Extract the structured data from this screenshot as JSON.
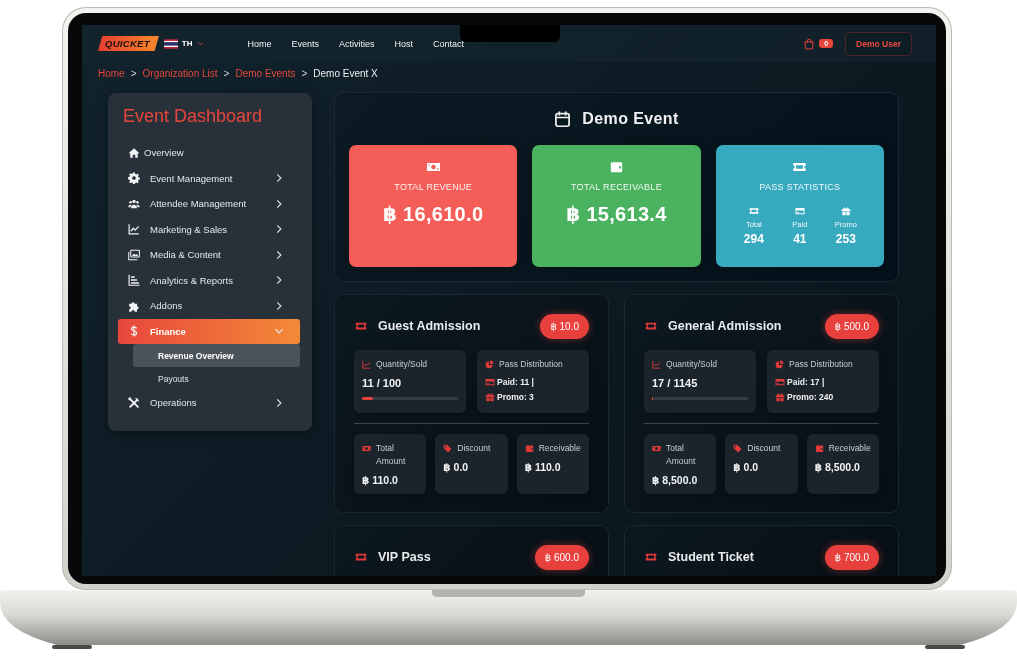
{
  "navbar": {
    "logo": "QUICKET",
    "language": "TH",
    "links": [
      {
        "label": "Home"
      },
      {
        "label": "Events"
      },
      {
        "label": "Activities"
      },
      {
        "label": "Host"
      },
      {
        "label": "Contact"
      }
    ],
    "cart_count": "0",
    "user_button": "Demo User"
  },
  "breadcrumb": [
    {
      "label": "Home",
      "kind": "link"
    },
    {
      "label": "Organization List",
      "kind": "link",
      "separator_before": ">"
    },
    {
      "label": "Demo Events",
      "kind": "link",
      "separator_before": ">"
    },
    {
      "label": "Demo Event X",
      "kind": "current",
      "separator_before": ">"
    }
  ],
  "sidebar": {
    "title": "Event Dashboard",
    "items": [
      {
        "label": "Overview",
        "kind": "link",
        "selected": false
      },
      {
        "label": "Event Management",
        "kind": "group",
        "selected": false,
        "expanded": false
      },
      {
        "label": "Attendee Management",
        "kind": "group",
        "selected": false,
        "expanded": false
      },
      {
        "label": "Marketing & Sales",
        "kind": "group",
        "selected": false,
        "expanded": false
      },
      {
        "label": "Media & Content",
        "kind": "group",
        "selected": false,
        "expanded": false
      },
      {
        "label": "Analytics & Reports",
        "kind": "group",
        "selected": false,
        "expanded": false
      },
      {
        "label": "Addons",
        "kind": "group",
        "selected": false,
        "expanded": false
      },
      {
        "label": "Finance",
        "kind": "group",
        "selected": true,
        "expanded": true,
        "children": [
          {
            "label": "Revenue Overview",
            "selected": true
          },
          {
            "label": "Payouts",
            "selected": false
          }
        ]
      },
      {
        "label": "Operations",
        "kind": "group",
        "selected": false,
        "expanded": false
      }
    ]
  },
  "event": {
    "title": "Demo Event",
    "stats": [
      {
        "kind": "amount",
        "label": "TOTAL REVENUE",
        "value": "฿ 16,610.0",
        "color": "#f45d58"
      },
      {
        "kind": "amount",
        "label": "TOTAL RECEIVABLE",
        "value": "฿ 15,613.4",
        "color": "#4bb360"
      },
      {
        "kind": "breakdown",
        "label": "PASS STATISTICS",
        "color": "#38aac0",
        "items": [
          {
            "label": "Total",
            "value": "294"
          },
          {
            "label": "Paid",
            "value": "41"
          },
          {
            "label": "Promo",
            "value": "253"
          }
        ]
      }
    ]
  },
  "tickets": [
    {
      "name": "Guest Admission",
      "price": "฿ 10.0",
      "quantity_label": "Quantity/Sold",
      "sold": "11 / 100",
      "level": 0.11,
      "distribution_label": "Pass Distribution",
      "paid": "Paid: 11 |",
      "promo": "Promo: 3",
      "amounts": [
        {
          "label": "Total Amount",
          "value": "฿ 110.0"
        },
        {
          "label": "Discount",
          "value": "฿ 0.0"
        },
        {
          "label": "Receivable",
          "value": "฿ 110.0"
        }
      ]
    },
    {
      "name": "General Admission",
      "price": "฿ 500.0",
      "quantity_label": "Quantity/Sold",
      "sold": "17 / 1145",
      "level": 0.015,
      "distribution_label": "Pass Distribution",
      "paid": "Paid: 17 |",
      "promo": "Promo: 240",
      "amounts": [
        {
          "label": "Total Amount",
          "value": "฿ 8,500.0"
        },
        {
          "label": "Discount",
          "value": "฿ 0.0"
        },
        {
          "label": "Receivable",
          "value": "฿ 8,500.0"
        }
      ]
    },
    {
      "name": "VIP Pass",
      "price": "฿ 600.0"
    },
    {
      "name": "Student Ticket",
      "price": "฿ 700.0"
    }
  ]
}
